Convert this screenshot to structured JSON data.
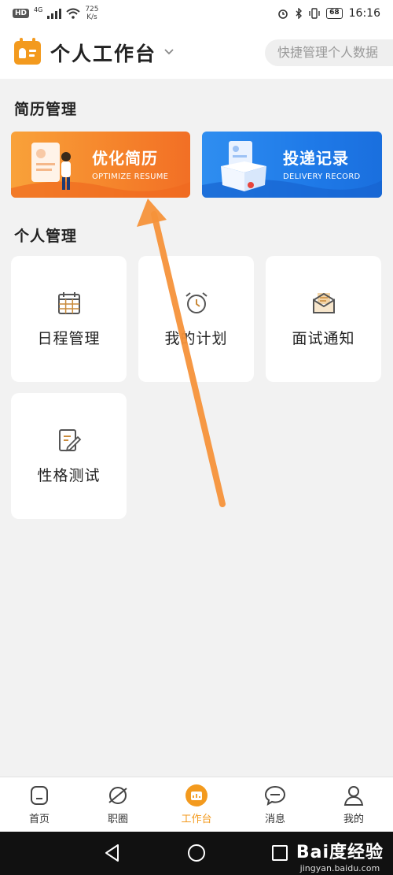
{
  "status_bar": {
    "hd": "HD",
    "network": "4G",
    "net_speed_value": "725",
    "net_speed_unit": "K/s",
    "battery": "68",
    "time": "16:16"
  },
  "header": {
    "title": "个人工作台",
    "search_placeholder": "快捷管理个人数据"
  },
  "resume_section": {
    "title": "简历管理",
    "banners": [
      {
        "title": "优化简历",
        "subtitle": "OPTIMIZE RESUME",
        "color": "#f5832b"
      },
      {
        "title": "投递记录",
        "subtitle": "DELIVERY RECORD",
        "color": "#1f7ae8"
      }
    ]
  },
  "personal_section": {
    "title": "个人管理",
    "tiles": [
      {
        "label": "日程管理",
        "icon": "calendar-icon"
      },
      {
        "label": "我的计划",
        "icon": "alarm-clock-icon"
      },
      {
        "label": "面试通知",
        "icon": "envelope-icon"
      },
      {
        "label": "性格测试",
        "icon": "edit-document-icon"
      }
    ]
  },
  "bottom_nav": {
    "items": [
      {
        "label": "首页",
        "icon": "home-icon"
      },
      {
        "label": "职圈",
        "icon": "planet-icon"
      },
      {
        "label": "工作台",
        "icon": "workbench-icon",
        "active": true
      },
      {
        "label": "消息",
        "icon": "message-icon"
      },
      {
        "label": "我的",
        "icon": "profile-icon"
      }
    ]
  },
  "colors": {
    "accent": "#f39a1e",
    "orange_banner": "#f5832b",
    "blue_banner": "#1f7ae8",
    "annotation_arrow": "#f5923a"
  },
  "watermark": {
    "logo": "Bai度经验",
    "url": "jingyan.baidu.com"
  }
}
